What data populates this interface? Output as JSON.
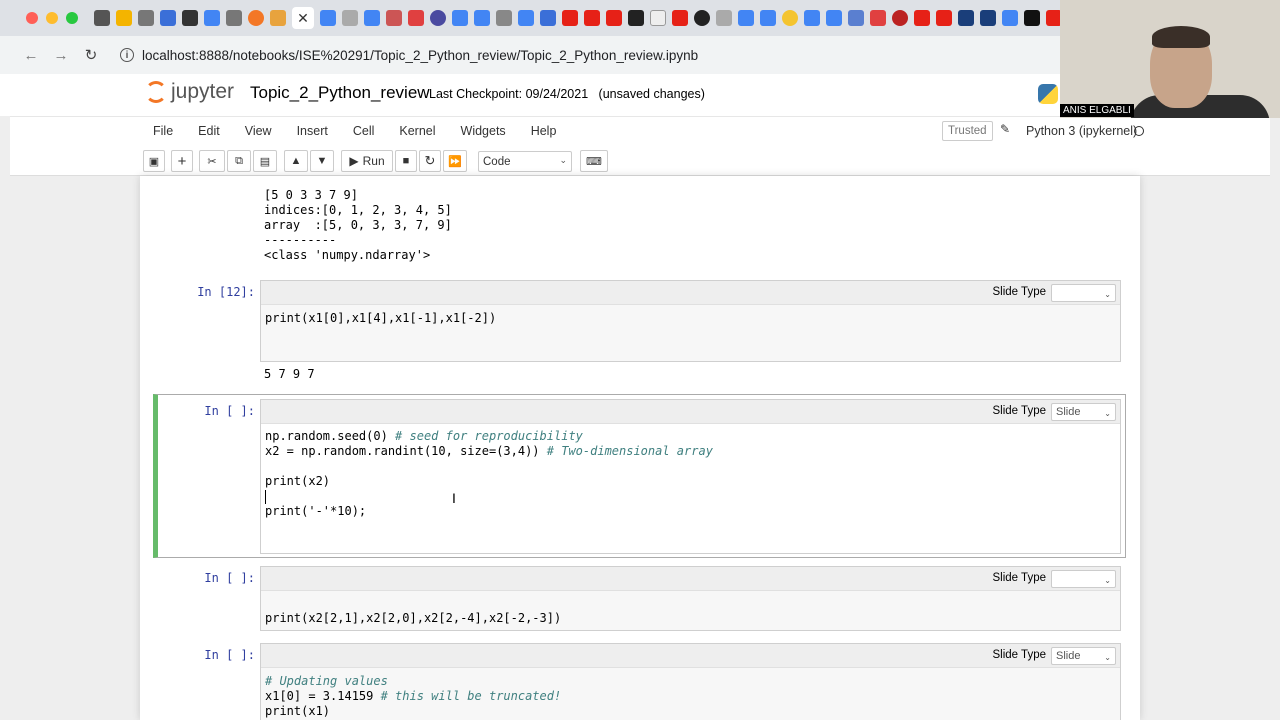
{
  "browser": {
    "url": "localhost:8888/notebooks/ISE%20291/Topic_2_Python_review/Topic_2_Python_review.ipynb"
  },
  "jupyter": {
    "logo_text": "jupyter",
    "title": "Topic_2_Python_review",
    "checkpoint": "Last Checkpoint: 09/24/2021   (unsaved changes)",
    "menu": [
      "File",
      "Edit",
      "View",
      "Insert",
      "Cell",
      "Kernel",
      "Widgets",
      "Help"
    ],
    "trusted": "Trusted",
    "kernel": "Python 3 (ipykernel)",
    "toolbar": {
      "run_label": "Run",
      "cell_type": "Code"
    }
  },
  "cells": {
    "prev_output": [
      "[5 0 3 3 7 9]",
      "indices:[0, 1, 2, 3, 4, 5]",
      "array  :[5, 0, 3, 3, 7, 9]",
      "----------",
      "<class 'numpy.ndarray'>"
    ],
    "c12": {
      "prompt": "In [12]:",
      "slide_label": "Slide Type",
      "slide_value": "",
      "code": "print(x1[0],x1[4],x1[-1],x1[-2])",
      "output": "5 7 9 7"
    },
    "c_sel": {
      "prompt": "In [ ]:",
      "slide_label": "Slide Type",
      "slide_value": "Slide",
      "line1_code": "np.random.seed(0) ",
      "line1_comment": "# seed for reproducibility",
      "line2_code": "x2 = np.random.randint(10, size=(3,4)) ",
      "line2_comment": "# Two-dimensional array",
      "line3": "print(x2)",
      "line5": "print('-'*10);"
    },
    "c_next": {
      "prompt": "In [ ]:",
      "slide_label": "Slide Type",
      "slide_value": "",
      "code": "print(x2[2,1],x2[2,0],x2[2,-4],x2[-2,-3])"
    },
    "c_last": {
      "prompt": "In [ ]:",
      "slide_label": "Slide Type",
      "slide_value": "Slide",
      "line1": "# Updating values",
      "line2_code": "x1[0] = 3.14159 ",
      "line2_comment": "# this will be truncated!",
      "line3": "print(x1)"
    }
  },
  "video": {
    "name": "ANIS ELGABLI"
  }
}
